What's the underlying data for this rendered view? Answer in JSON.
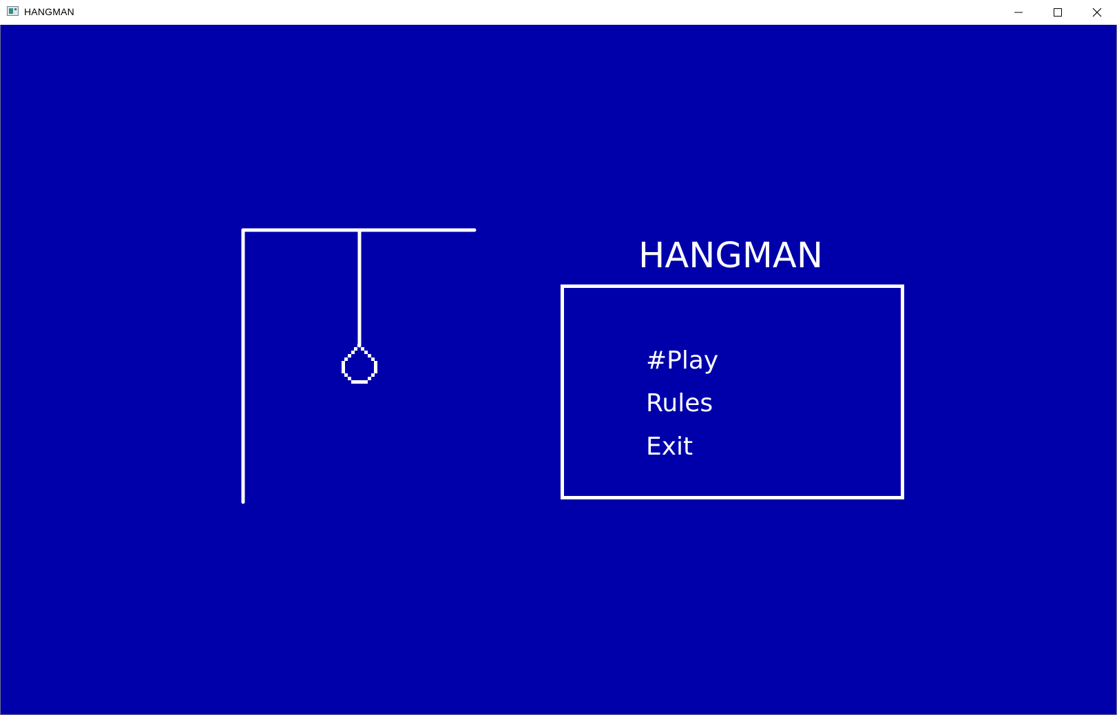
{
  "window": {
    "title": "HANGMAN",
    "icon": "app-window-icon",
    "controls": {
      "minimize_icon": "minimize-icon",
      "maximize_icon": "maximize-icon",
      "close_icon": "close-icon"
    }
  },
  "game": {
    "title": "HANGMAN",
    "background_color": "#0000AB",
    "foreground_color": "#FFFFFF",
    "menu": {
      "items": [
        {
          "label": "#Play"
        },
        {
          "label": "Rules"
        },
        {
          "label": "Exit"
        }
      ]
    }
  }
}
